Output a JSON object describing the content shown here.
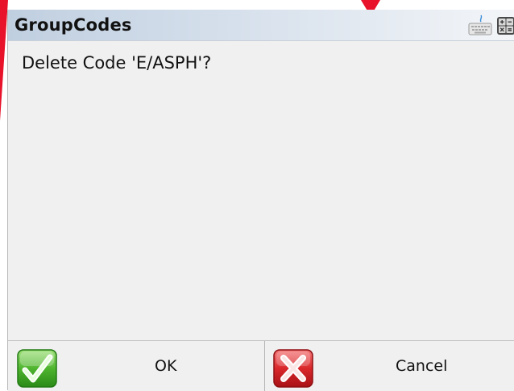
{
  "dialog": {
    "title": "GroupCodes",
    "message": "Delete Code 'E/ASPH'?",
    "icons": {
      "keyboard": "keyboard-icon",
      "calculator": "calculator-icon"
    }
  },
  "buttons": {
    "ok": {
      "label": "OK",
      "icon": "checkmark-icon",
      "color": "#2e9b1e"
    },
    "cancel": {
      "label": "Cancel",
      "icon": "red-x-icon",
      "color": "#d2181c"
    }
  },
  "colors": {
    "background_accent": "#e8122a",
    "dialog_body": "#f0f0f0",
    "titlebar_start": "#c0cfe0",
    "titlebar_end": "#f3f5f8"
  }
}
